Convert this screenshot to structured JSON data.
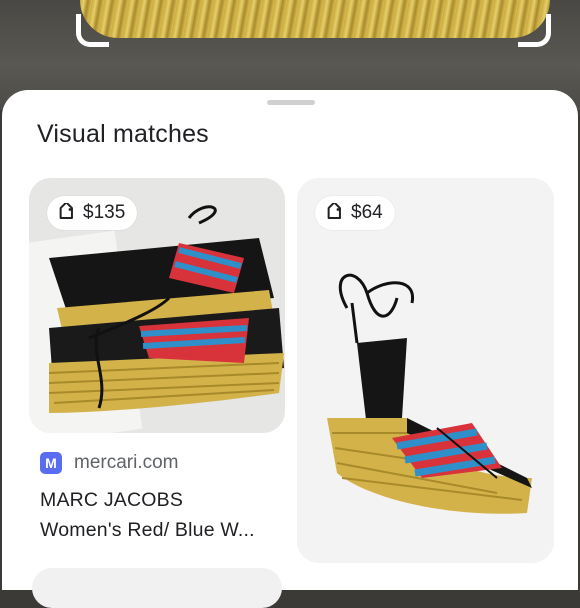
{
  "section_title": "Visual matches",
  "results": [
    {
      "price": "$135",
      "source": "mercari.com",
      "source_initial": "M",
      "title_line1": "MARC JACOBS",
      "title_line2": "Women's Red/ Blue W..."
    },
    {
      "price": "$64"
    }
  ],
  "icons": {
    "tag": "price-tag-icon",
    "favicon": "mercari-favicon-icon"
  },
  "colors": {
    "sheet_bg": "#ffffff",
    "card_bg": "#f1f1f1",
    "favicon": "#5a6df0",
    "strap_red": "#d8333b",
    "strap_blue": "#2f8fc9",
    "espadrille_gold": "#d3b24a"
  }
}
